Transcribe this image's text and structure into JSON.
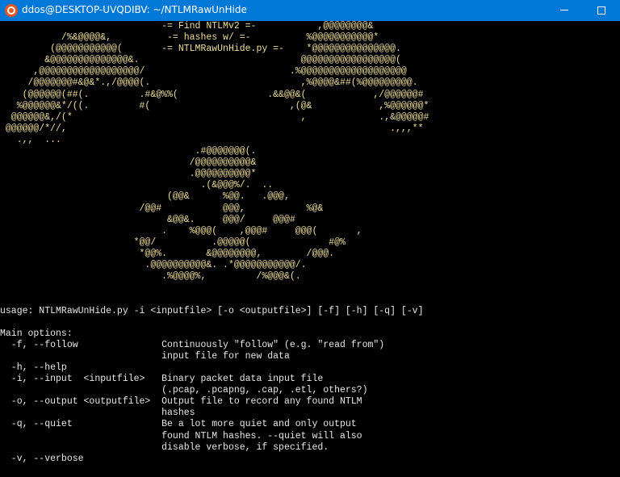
{
  "window": {
    "title": "ddos@DESKTOP-UVQDIBV: ~/NTLMRawUnHide",
    "app_icon": "ubuntu-icon",
    "controls": [
      "minimize-icon",
      "maximize-icon"
    ],
    "titlebar_color": "#0078d7"
  },
  "terminal": {
    "banner_color": "#eedd9a",
    "text_color": "#e6e6e6",
    "banner_lines": [
      "                             -= Find NTLMv2 =-           ,@@@@@@@@&",
      "           /%&@@@@&,          -= hashes w/ =-          %@@@@@@@@@@@*",
      "         (@@@@@@@@@@@(       -= NTLMRawUnHide.py =-    *@@@@@@@@@@@@@@@.",
      "        &@@@@@@@@@@@@@@&.                             @@@@@@@@@@@@@@@@@(",
      "      ,@@@@@@@@@@@@@@@@@@/                          .%@@@@@@@@@@@@@@@@@@@",
      "     /@@@@@@@#&@&*.,/@@@@(.                           ,%@@@@&##(%@@@@@@@@@.",
      "    (@@@@@@(##(.         .#&@%%(                .&&@@&(            ,/@@@@@@#",
      "   %@@@@@@&*/((.         #(                         ,(@&            ,%@@@@@@*",
      "  @@@@@@&,/(*                                         ,             .,&@@@@@#",
      " @@@@@@/*//,                                                          .,,,**",
      "   .,,  ...",
      "                                   .#@@@@@@@(.",
      "                                  /@@@@@@@@@@&",
      "                                  .@@@@@@@@@@*",
      "                                    .(&@@@%/.  ..",
      "                              (@@&      %@@.   .@@@,",
      "                         /@@#           @@@,           %@&",
      "                              &@@&.     @@@/     @@@#",
      "                             .    %@@@(    ,@@@#     @@@(       ,",
      "                        *@@/          .@@@@@(              #@%",
      "                         *@@%.       &@@@@@@@@,        /@@@.",
      "                          .@@@@@@@@@@&. .*@@@@@@@@@@@/.",
      "                             .%@@@@%,         /%@@@&(."
    ],
    "blank_lines_after_banner": 2,
    "help_lines": [
      "usage: NTLMRawUnHide.py -i <inputfile> [-o <outputfile>] [-f] [-h] [-q] [-v]",
      "",
      "Main options:",
      "  -f, --follow               Continuously \"follow\" (e.g. \"read from\")",
      "                             input file for new data",
      "  -h, --help",
      "  -i, --input  <inputfile>   Binary packet data input file",
      "                             (.pcap, .pcapng, .cap, .etl, others?)",
      "  -o, --output <outputfile>  Output file to record any found NTLM",
      "                             hashes",
      "  -q, --quiet                Be a lot more quiet and only output",
      "                             found NTLM hashes. --quiet will also",
      "                             disable verbose, if specified.",
      "  -v, --verbose"
    ]
  }
}
